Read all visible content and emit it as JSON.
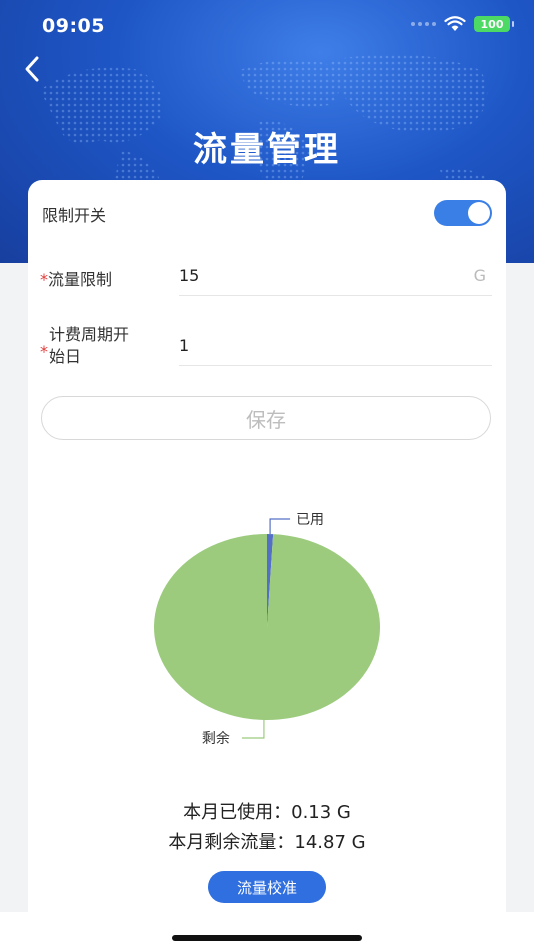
{
  "status": {
    "time": "09:05",
    "battery": "100"
  },
  "header": {
    "title": "流量管理"
  },
  "form": {
    "limit_switch_label": "限制开关",
    "limit_switch_on": true,
    "traffic_limit_label": "流量限制",
    "traffic_limit_value": "15",
    "traffic_limit_unit": "G",
    "billing_day_label_line1": "计费周期开",
    "billing_day_label_line2": "始日",
    "billing_day_value": "1",
    "required_mark": "*",
    "save_label": "保存"
  },
  "chart_data": {
    "type": "pie",
    "slices": [
      {
        "label": "已用",
        "value": 0.13,
        "color": "#5470c6"
      },
      {
        "label": "剩余",
        "value": 14.87,
        "color": "#9ccb7e"
      }
    ]
  },
  "summary": {
    "used_text": "本月已使用：0.13 G",
    "remaining_text": "本月剩余流量：14.87 G"
  },
  "actions": {
    "calibrate_label": "流量校准"
  },
  "colors": {
    "accent": "#2f6fe0",
    "used": "#5470c6",
    "remaining": "#9ccb7e"
  }
}
